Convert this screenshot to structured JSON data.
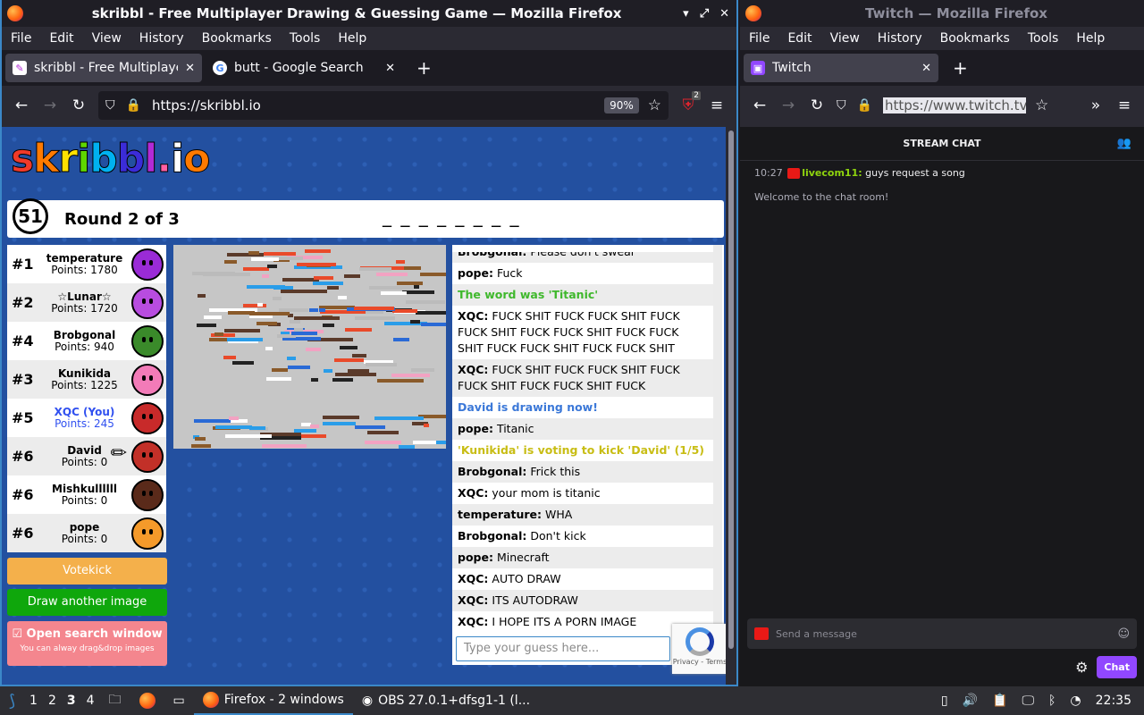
{
  "win1": {
    "title": "skribbl - Free Multiplayer Drawing & Guessing Game — Mozilla Firefox",
    "menu": [
      "File",
      "Edit",
      "View",
      "History",
      "Bookmarks",
      "Tools",
      "Help"
    ],
    "tabs": [
      {
        "label": "skribbl - Free Multiplayer",
        "icon": "skribbl-favicon"
      },
      {
        "label": "butt - Google Search",
        "icon": "google-favicon"
      }
    ],
    "url": "https://skribbl.io",
    "zoom": "90%",
    "ext_badge": "2"
  },
  "skribbl": {
    "logo_letters": [
      "s",
      "k",
      "r",
      "i",
      "b",
      "b",
      "l",
      ".",
      "i",
      "o"
    ],
    "timer": "51",
    "round": "Round 2 of 3",
    "word_hint": "_ _ _ _ _ _ _ _",
    "players": [
      {
        "rank": "#1",
        "name": "temperature",
        "points": "Points: 1780",
        "color": "#9a2bd6"
      },
      {
        "rank": "#2",
        "name": "☆Lunar☆",
        "points": "Points: 1720",
        "color": "#b84ce0"
      },
      {
        "rank": "#4",
        "name": "Brobgonal",
        "points": "Points: 940",
        "color": "#3a8a2a"
      },
      {
        "rank": "#3",
        "name": "Kunikida",
        "points": "Points: 1225",
        "color": "#f27bb8"
      },
      {
        "rank": "#5",
        "name": "XQC (You)",
        "points": "Points: 245",
        "color": "#c82a2a"
      },
      {
        "rank": "#6",
        "name": "David",
        "points": "Points: 0",
        "color": "#c23028"
      },
      {
        "rank": "#6",
        "name": "Mishkullllll",
        "points": "Points: 0",
        "color": "#5a2a1a"
      },
      {
        "rank": "#6",
        "name": "pope",
        "points": "Points: 0",
        "color": "#f59a2a"
      }
    ],
    "votekick": "Votekick",
    "draw_another": "Draw another image",
    "open_search": "Open search window",
    "search_sub": "You can alway drag&drop images",
    "guess_placeholder": "Type your guess here...",
    "recaptcha": "Privacy - Terms",
    "chat": [
      {
        "user": "Brobgonal:",
        "text": " Please don't swear",
        "type": "msg"
      },
      {
        "user": "pope:",
        "text": " Fuck",
        "type": "msg"
      },
      {
        "user": "",
        "text": "The word was 'Titanic'",
        "type": "green"
      },
      {
        "user": "XQC:",
        "text": " FUCK SHIT FUCK FUCK SHIT FUCK FUCK SHIT FUCK FUCK SHIT FUCK FUCK SHIT FUCK FUCK SHIT FUCK FUCK SHIT",
        "type": "msg"
      },
      {
        "user": "XQC:",
        "text": " FUCK SHIT FUCK FUCK SHIT FUCK FUCK SHIT FUCK FUCK SHIT FUCK",
        "type": "msg"
      },
      {
        "user": "",
        "text": "David is drawing now!",
        "type": "blue"
      },
      {
        "user": "pope:",
        "text": " Titanic",
        "type": "msg"
      },
      {
        "user": "",
        "text": "'Kunikida' is voting to kick 'David' (1/5)",
        "type": "yellow"
      },
      {
        "user": "Brobgonal:",
        "text": " Frick this",
        "type": "msg"
      },
      {
        "user": "XQC:",
        "text": " your mom is titanic",
        "type": "msg"
      },
      {
        "user": "temperature:",
        "text": " WHA",
        "type": "msg"
      },
      {
        "user": "Brobgonal:",
        "text": " Don't kick",
        "type": "msg"
      },
      {
        "user": "pope:",
        "text": " Minecraft",
        "type": "msg"
      },
      {
        "user": "XQC:",
        "text": " AUTO DRAW",
        "type": "msg"
      },
      {
        "user": "XQC:",
        "text": " ITS AUTODRAW",
        "type": "msg"
      },
      {
        "user": "XQC:",
        "text": " I HOPE ITS A PORN IMAGE",
        "type": "msg"
      }
    ]
  },
  "win2": {
    "title": "Twitch — Mozilla Firefox",
    "menu": [
      "File",
      "Edit",
      "View",
      "History",
      "Bookmarks",
      "Tools",
      "Help"
    ],
    "tab": "Twitch",
    "url": "https://www.twitch.tv/",
    "chat_header": "STREAM CHAT",
    "msg_time": "10:27",
    "msg_user": "livecom11:",
    "msg_text": " guys request a song",
    "system_msg": "Welcome to the chat room!",
    "input_placeholder": "Send a message",
    "chat_button": "Chat"
  },
  "taskbar": {
    "workspaces": [
      "1",
      "2",
      "3",
      "4"
    ],
    "current_workspace": "3",
    "firefox_item": "Firefox - 2 windows",
    "obs_item": "OBS 27.0.1+dfsg1-1 (l...",
    "clock": "22:35"
  }
}
